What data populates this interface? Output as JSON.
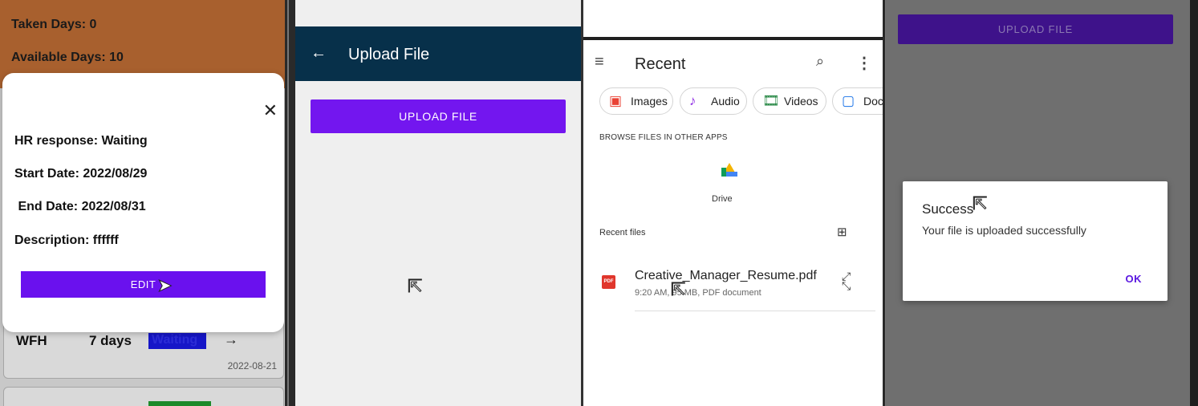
{
  "panel1": {
    "taken_days": "Taken Days:  0",
    "available_days": "Available Days: 10",
    "modal": {
      "close_icon": "close-icon",
      "hr_response": "HR response: Waiting",
      "start_date": "Start Date: 2022/08/29",
      "end_date": " End Date: 2022/08/31",
      "description": "Description: ffffff",
      "edit_label": "EDIT"
    },
    "leave_item": {
      "type": "WFH",
      "days": "7 days",
      "status": "Waiting",
      "arrow": "→",
      "date": "2022-08-21"
    }
  },
  "panel2": {
    "back_icon": "←",
    "title": "Upload File",
    "upload_label": "UPLOAD FILE"
  },
  "panel3": {
    "menu_icon": "≡",
    "header": "Recent",
    "search_icon": "⌕",
    "more_icon": "⋮",
    "chips": [
      {
        "label": "Images",
        "icon": "▣",
        "color": "#e94235"
      },
      {
        "label": "Audio",
        "icon": "♪",
        "color": "#9334e6"
      },
      {
        "label": "Videos",
        "icon": "🎞",
        "color": "#188038"
      },
      {
        "label": "Doc",
        "icon": "▢",
        "color": "#1a73e8"
      }
    ],
    "browse_label": "BROWSE FILES IN OTHER APPS",
    "drive_label": "Drive",
    "recent_files_label": "Recent files",
    "grid_icon": "⊞",
    "file": {
      "icon_text": "PDF",
      "name": "Creative_Manager_Resume.pdf",
      "meta": "9:20 AM, 95 MB, PDF document",
      "expand_icon": "⤡"
    }
  },
  "panel4": {
    "upload_label": "UPLOAD FILE",
    "dialog": {
      "title": "Success",
      "message": "Your file is uploaded successfully",
      "ok_label": "OK"
    }
  }
}
